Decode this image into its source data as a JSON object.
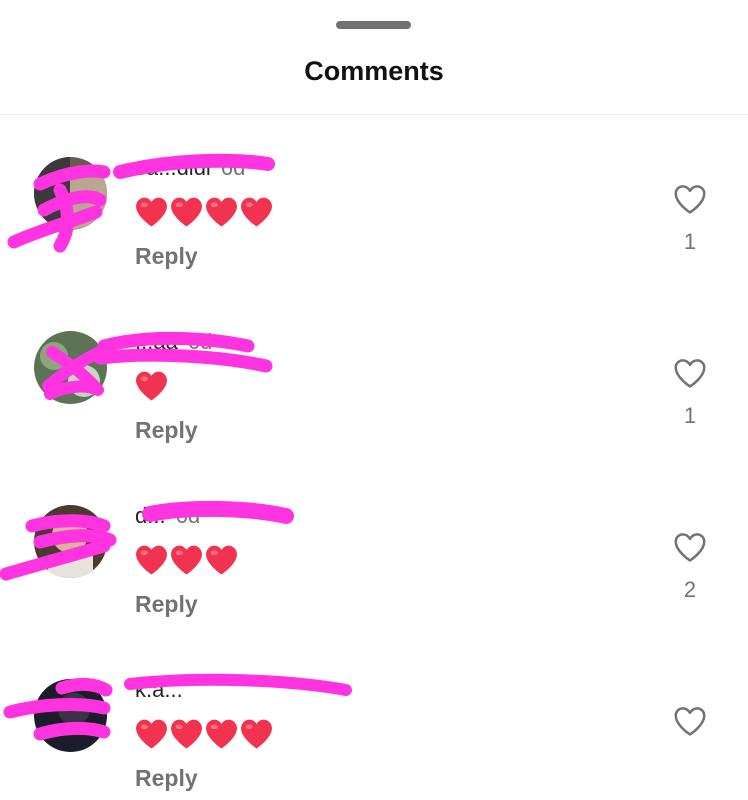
{
  "sheet": {
    "title": "Comments"
  },
  "colors": {
    "redaction": "#ff33e0",
    "heart": "#f2334f",
    "muted": "#737373"
  },
  "comments": [
    {
      "username": "sa...dldi",
      "time": "6d",
      "hearts": 4,
      "reply_label": "Reply",
      "likes": "1"
    },
    {
      "username": "...aa",
      "time": "6d",
      "hearts": 1,
      "reply_label": "Reply",
      "likes": "1"
    },
    {
      "username": "d...",
      "time": "6d",
      "hearts": 3,
      "reply_label": "Reply",
      "likes": "2"
    },
    {
      "username": "k.a...",
      "time": "",
      "hearts": 4,
      "reply_label": "Reply",
      "likes": ""
    }
  ]
}
